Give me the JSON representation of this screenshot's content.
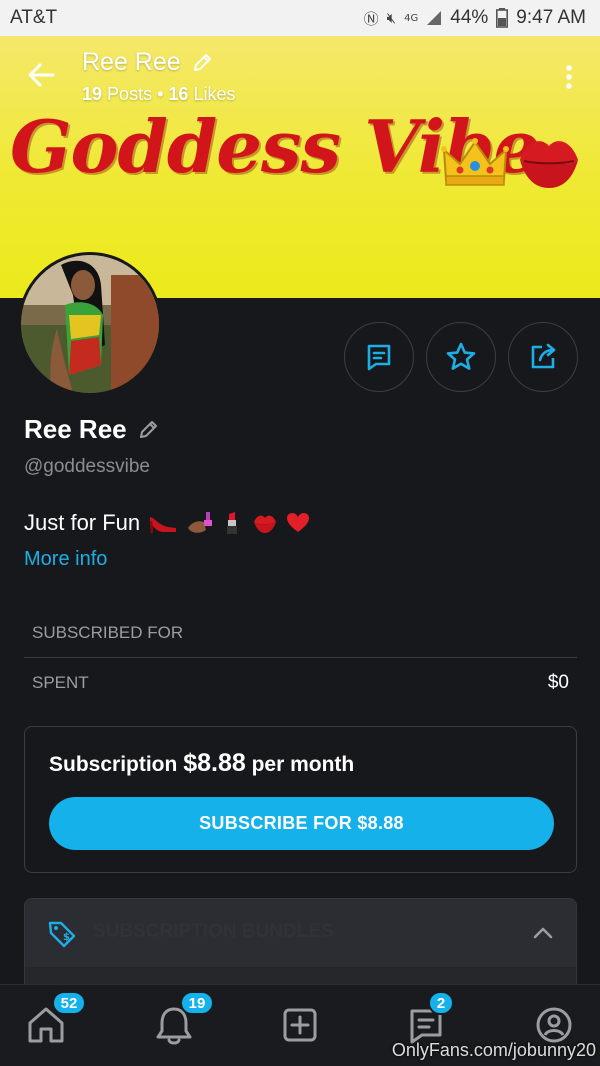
{
  "status_bar": {
    "carrier": "AT&T",
    "battery": "44%",
    "time": "9:47 AM",
    "network": "4G LTE"
  },
  "header": {
    "name": "Ree Ree",
    "posts_count": "19",
    "posts_label": "Posts",
    "likes_count": "16",
    "likes_label": "Likes"
  },
  "banner": {
    "title_text": "Goddess Vibe"
  },
  "profile": {
    "name": "Ree Ree",
    "handle": "@goddessvibe",
    "bio": "Just for Fun",
    "more_info": "More info"
  },
  "stats": {
    "subscribed_for_label": "SUBSCRIBED FOR",
    "spent_label": "SPENT",
    "spent_value": "$0"
  },
  "subscription": {
    "prefix": "Subscription",
    "price": "$8.88",
    "suffix": "per month",
    "button_label": "SUBSCRIBE FOR $8.88"
  },
  "bundles": {
    "title": "SUBSCRIPTION BUNDLES"
  },
  "nav": {
    "home_badge": "52",
    "notifications_badge": "19",
    "messages_badge": "2"
  },
  "watermark": "OnlyFans.com/jobunny20",
  "colors": {
    "accent": "#14b1eb",
    "background": "#17181b",
    "banner_yellow": "#efe933",
    "banner_text_red": "#d2151b"
  }
}
